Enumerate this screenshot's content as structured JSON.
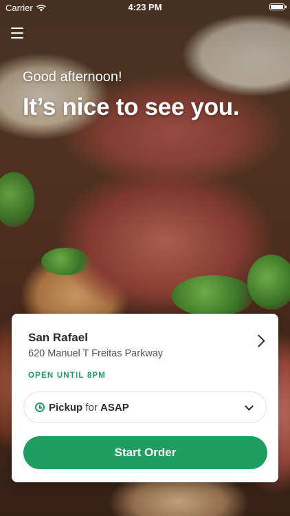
{
  "status_bar": {
    "carrier": "Carrier",
    "time": "4:23 PM"
  },
  "hero": {
    "greeting": "Good afternoon!",
    "headline": "It’s nice to see you."
  },
  "store": {
    "name": "San Rafael",
    "address": "620 Manuel T Freitas Parkway",
    "open_status": "OPEN UNTIL 8PM"
  },
  "order_mode": {
    "mode_label": "Pickup",
    "connector": "for",
    "time_label": "ASAP"
  },
  "actions": {
    "start_order_label": "Start Order"
  },
  "colors": {
    "accent_green": "#1f9e62",
    "card_background": "#ffffff"
  },
  "icons": [
    "wifi-icon",
    "battery-icon",
    "menu-icon",
    "chevron-right-icon",
    "clock-icon",
    "chevron-down-icon"
  ]
}
